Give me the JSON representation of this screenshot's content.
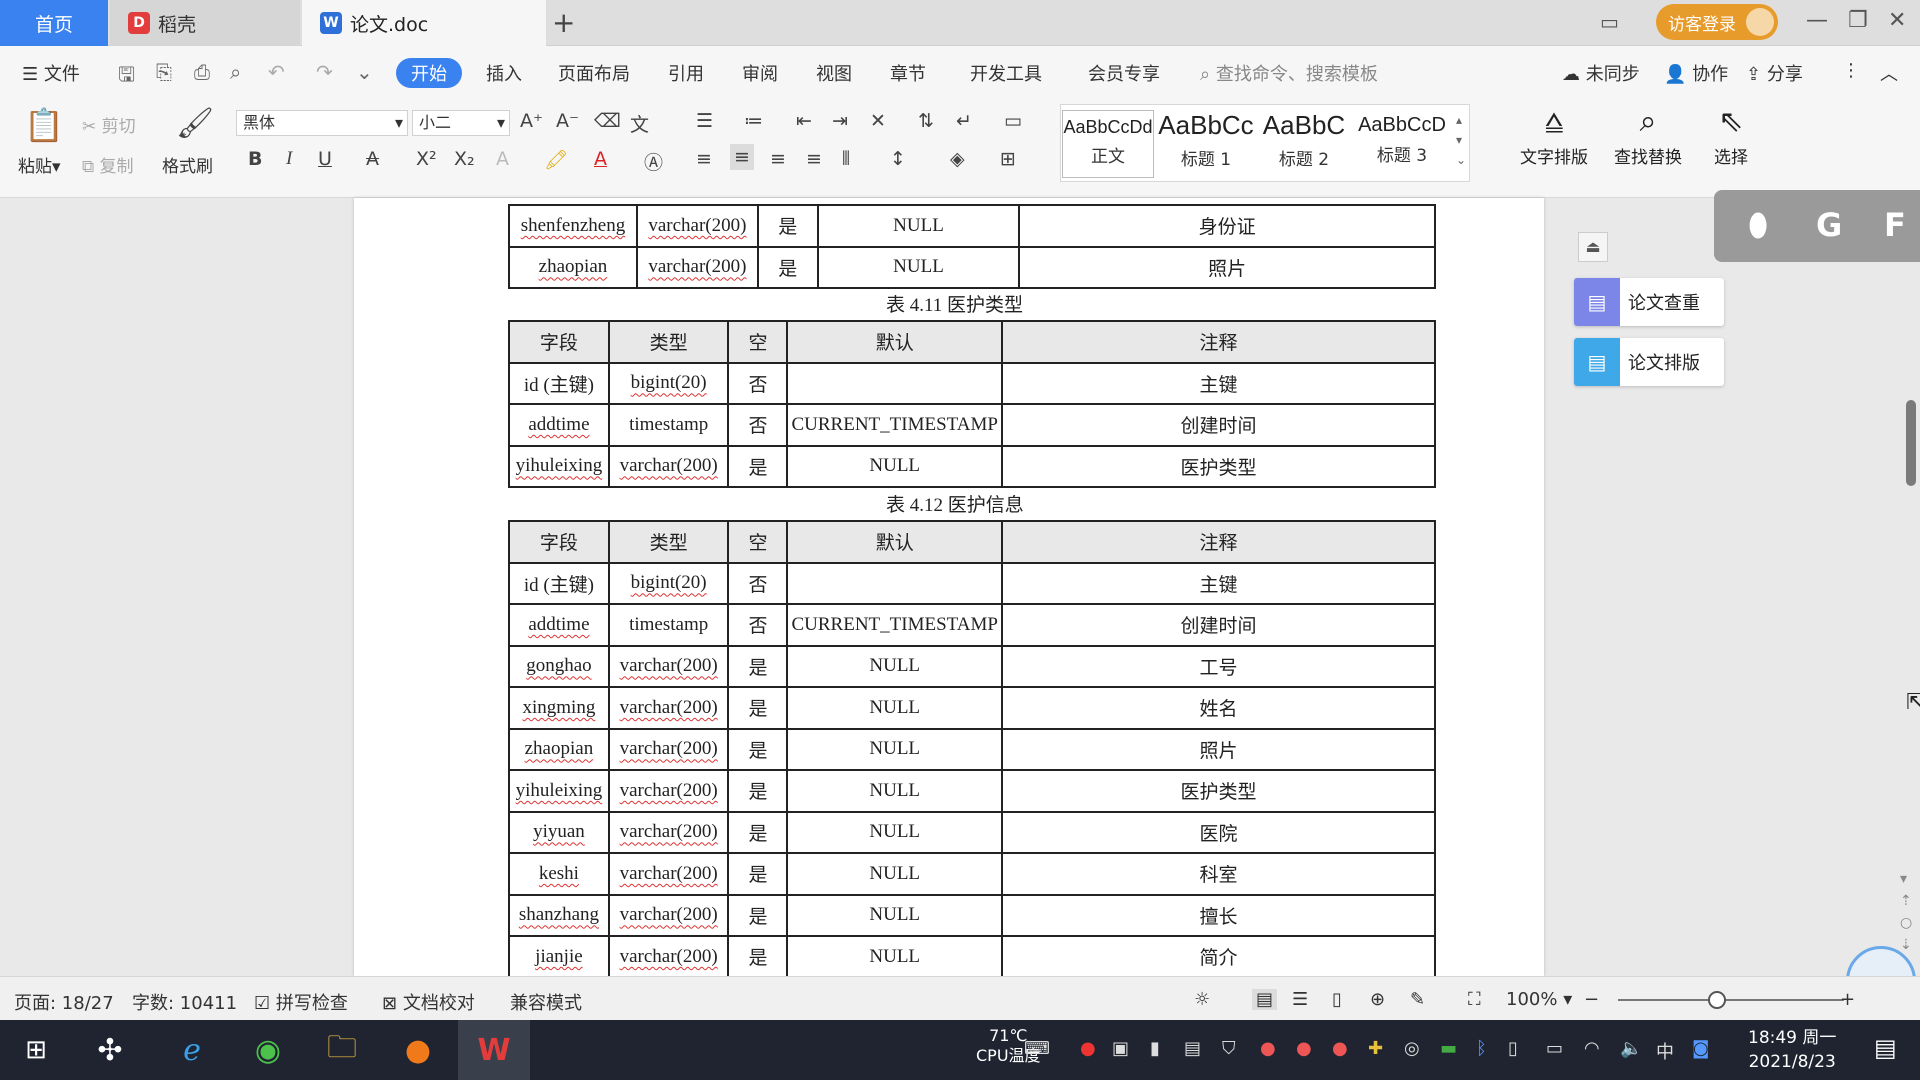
{
  "tabs": {
    "home": "首页",
    "daoke": "稻壳",
    "doc": "论文.doc",
    "new_tab": "+"
  },
  "account": {
    "login": "访客登录"
  },
  "menu": {
    "file": "文件",
    "items": [
      "开始",
      "插入",
      "页面布局",
      "引用",
      "审阅",
      "视图",
      "章节",
      "开发工具",
      "会员专享"
    ],
    "search_placeholder": "查找命令、搜索模板",
    "sync": "未同步",
    "collab": "协作",
    "share": "分享"
  },
  "ribbon": {
    "paste": "粘贴",
    "cut": "剪切",
    "copy": "复制",
    "format_painter": "格式刷",
    "font_name": "黑体",
    "font_size": "小二",
    "styles": [
      {
        "sample": "AaBbCcDd",
        "name": "正文"
      },
      {
        "sample": "AaBbCc",
        "name": "标题 1"
      },
      {
        "sample": "AaBbC",
        "name": "标题 2"
      },
      {
        "sample": "AaBbCcD",
        "name": "标题 3"
      }
    ],
    "text_layout": "文字排版",
    "find_replace": "查找替换",
    "select": "选择"
  },
  "document": {
    "top_table": [
      [
        "shenfenzheng",
        "varchar(200)",
        "是",
        "NULL",
        "身份证"
      ],
      [
        "zhaopian",
        "varchar(200)",
        "是",
        "NULL",
        "照片"
      ]
    ],
    "table1": {
      "caption": "表 4.11 医护类型",
      "header": [
        "字段",
        "类型",
        "空",
        "默认",
        "注释"
      ],
      "rows": [
        [
          "id (主键)",
          "bigint(20)",
          "否",
          "",
          "主键"
        ],
        [
          "addtime",
          "timestamp",
          "否",
          "CURRENT_TIMESTAMP",
          "创建时间"
        ],
        [
          "yihuleixing",
          "varchar(200)",
          "是",
          "NULL",
          "医护类型"
        ]
      ]
    },
    "table2": {
      "caption": "表 4.12 医护信息",
      "header": [
        "字段",
        "类型",
        "空",
        "默认",
        "注释"
      ],
      "rows": [
        [
          "id (主键)",
          "bigint(20)",
          "否",
          "",
          "主键"
        ],
        [
          "addtime",
          "timestamp",
          "否",
          "CURRENT_TIMESTAMP",
          "创建时间"
        ],
        [
          "gonghao",
          "varchar(200)",
          "是",
          "NULL",
          "工号"
        ],
        [
          "xingming",
          "varchar(200)",
          "是",
          "NULL",
          "姓名"
        ],
        [
          "zhaopian",
          "varchar(200)",
          "是",
          "NULL",
          "照片"
        ],
        [
          "yihuleixing",
          "varchar(200)",
          "是",
          "NULL",
          "医护类型"
        ],
        [
          "yiyuan",
          "varchar(200)",
          "是",
          "NULL",
          "医院"
        ],
        [
          "keshi",
          "varchar(200)",
          "是",
          "NULL",
          "科室"
        ],
        [
          "shanzhang",
          "varchar(200)",
          "是",
          "NULL",
          "擅长"
        ],
        [
          "jianjie",
          "varchar(200)",
          "是",
          "NULL",
          "简介"
        ]
      ]
    }
  },
  "side_panel": {
    "check": "论文查重",
    "layout": "论文排版",
    "float_letters": [
      "G",
      "F"
    ]
  },
  "status": {
    "page": "页面: 18/27",
    "words": "字数: 10411",
    "spell": "拼写检查",
    "proof": "文档校对",
    "compat": "兼容模式",
    "zoom": "100%"
  },
  "taskbar": {
    "temp": "71℃",
    "cpu": "CPU温度",
    "ime": "中",
    "time": "18:49 周一",
    "date": "2021/8/23"
  },
  "colors": {
    "accent": "#3a82f0",
    "login": "#e79b2b",
    "taskbar": "#1f2430"
  }
}
